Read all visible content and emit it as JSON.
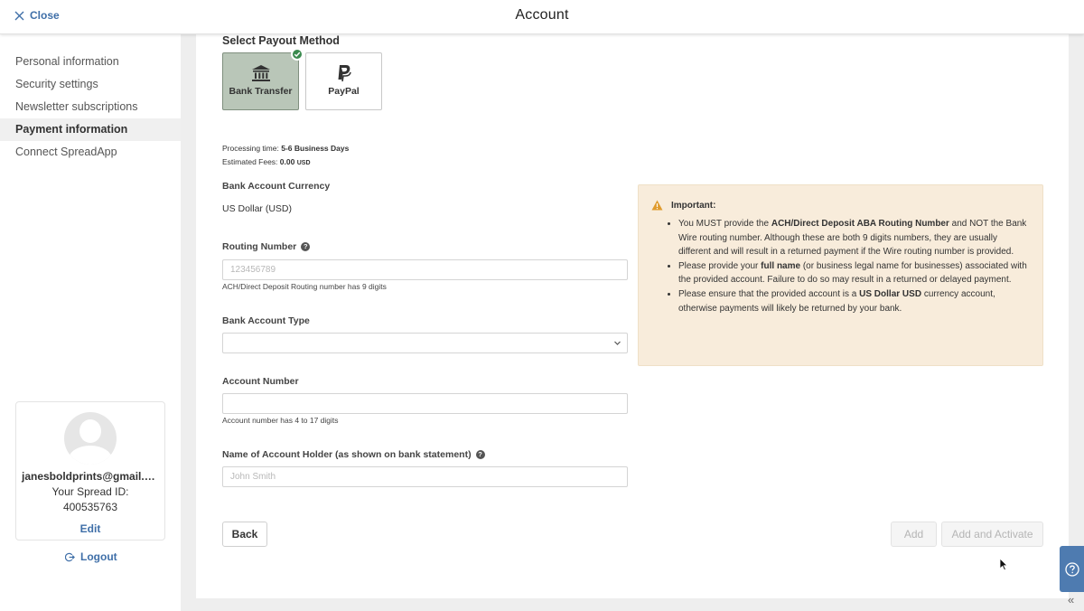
{
  "header": {
    "close_label": "Close",
    "title": "Account"
  },
  "sidebar": {
    "items": [
      {
        "label": "Personal information"
      },
      {
        "label": "Security settings"
      },
      {
        "label": "Newsletter subscriptions"
      },
      {
        "label": "Payment information",
        "active": true
      },
      {
        "label": "Connect SpreadApp"
      }
    ],
    "profile": {
      "email": "janesboldprints@gmail.c...",
      "spread_id_label": "Your Spread ID:",
      "spread_id": "400535763",
      "edit_label": "Edit"
    },
    "logout_label": "Logout"
  },
  "payout": {
    "title": "Select Payout Method",
    "methods": [
      {
        "label": "Bank Transfer",
        "icon": "bank-icon",
        "selected": true
      },
      {
        "label": "PayPal",
        "icon": "paypal-icon",
        "selected": false
      }
    ],
    "processing_label": "Processing time:",
    "processing_value": "5-6 Business Days",
    "fees_label": "Estimated Fees:",
    "fees_value": "0.00",
    "fees_currency": "USD"
  },
  "form": {
    "currency_label": "Bank Account Currency",
    "currency_value": "US Dollar (USD)",
    "routing_label": "Routing Number",
    "routing_placeholder": "123456789",
    "routing_hint": "ACH/Direct Deposit Routing number has 9 digits",
    "account_type_label": "Bank Account Type",
    "account_type_value": "",
    "account_number_label": "Account Number",
    "account_number_value": "",
    "account_number_hint": "Account number has 4 to 17 digits",
    "holder_label": "Name of Account Holder (as shown on bank statement)",
    "holder_placeholder": "John Smith"
  },
  "important": {
    "heading": "Important:",
    "items": [
      {
        "pre": "You MUST provide the ",
        "bold": "ACH/Direct Deposit ABA Routing Number",
        "post": " and NOT the Bank Wire routing number. Although these are both 9 digits numbers, they are usually different and will result in a returned payment if the Wire routing number is provided."
      },
      {
        "pre": "Please provide your ",
        "bold": "full name",
        "post": " (or business legal name for businesses) associated with the provided account. Failure to do so may result in a returned or delayed payment."
      },
      {
        "pre": "Please ensure that the provided account is a ",
        "bold": "US Dollar USD",
        "post": " currency account, otherwise payments will likely be returned by your bank."
      }
    ]
  },
  "buttons": {
    "back": "Back",
    "add": "Add",
    "add_activate": "Add and Activate"
  },
  "colors": {
    "accent": "#3f6fa8",
    "selected_method": "#b9c6b8",
    "check": "#3a8a4e",
    "important_bg": "#f8ecdb",
    "help_fab": "#4e7bb0"
  }
}
